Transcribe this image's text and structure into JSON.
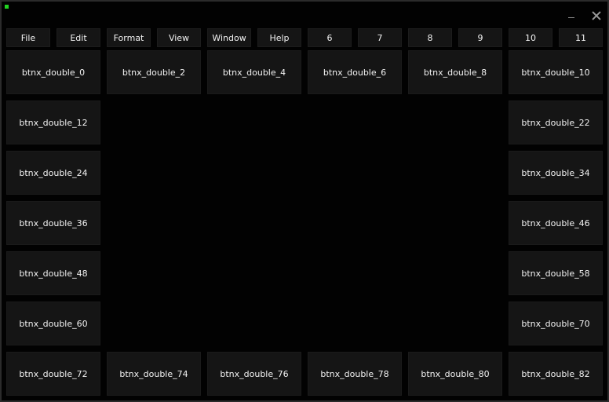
{
  "window": {
    "app_icon": "green-square-icon",
    "controls": {
      "minimize_icon": "minimize-icon",
      "close_icon": "close-icon"
    }
  },
  "menu": {
    "items": [
      "File",
      "Edit",
      "Format",
      "View",
      "Window",
      "Help",
      "6",
      "7",
      "8",
      "9",
      "10",
      "11"
    ]
  },
  "grid": {
    "top_row": [
      "btnx_double_0",
      "btnx_double_2",
      "btnx_double_4",
      "btnx_double_6",
      "btnx_double_8",
      "btnx_double_10"
    ],
    "left_column": [
      "btnx_double_12",
      "btnx_double_24",
      "btnx_double_36",
      "btnx_double_48",
      "btnx_double_60"
    ],
    "right_column": [
      "btnx_double_22",
      "btnx_double_34",
      "btnx_double_46",
      "btnx_double_58",
      "btnx_double_70"
    ],
    "bottom_row": [
      "btnx_double_72",
      "btnx_double_74",
      "btnx_double_76",
      "btnx_double_78",
      "btnx_double_80",
      "btnx_double_82"
    ]
  }
}
